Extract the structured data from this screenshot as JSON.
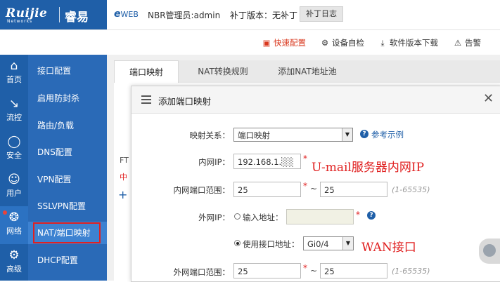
{
  "brand": {
    "logo_text": "Ruijie",
    "logo_sub": "Networks",
    "logo_cn": "睿易"
  },
  "header": {
    "eweb": "e",
    "eweb_suffix": "WEB",
    "admin_label": "NBR管理员:admin",
    "patch_label": "补丁版本：无补丁",
    "patch_log_button": "补丁日志"
  },
  "toolbar": {
    "quick_config": "快速配置",
    "device_check": "设备自检",
    "software_download": "软件版本下载",
    "alert": "告警"
  },
  "nav": [
    {
      "label": "首页",
      "icon": "home-icon"
    },
    {
      "label": "流控",
      "icon": "chart-icon"
    },
    {
      "label": "安全",
      "icon": "shield-icon"
    },
    {
      "label": "用户",
      "icon": "user-icon"
    },
    {
      "label": "网络",
      "icon": "globe-icon"
    },
    {
      "label": "高级",
      "icon": "gear-icon"
    }
  ],
  "subnav": [
    {
      "label": "接口配置"
    },
    {
      "label": "启用防封杀"
    },
    {
      "label": "路由/负载"
    },
    {
      "label": "DNS配置"
    },
    {
      "label": "VPN配置"
    },
    {
      "label": "SSLVPN配置"
    },
    {
      "label": "NAT/端口映射"
    },
    {
      "label": "DHCP配置"
    }
  ],
  "tabs": [
    {
      "label": "端口映射"
    },
    {
      "label": "NAT转换规则"
    },
    {
      "label": "添加NAT地址池"
    }
  ],
  "background": {
    "ft": "FT",
    "zh": "中",
    "plus": "+"
  },
  "dialog": {
    "title": "添加端口映射",
    "mapping_label": "映射关系：",
    "mapping_value": "端口映射",
    "example_link": "参考示例",
    "inner_ip_label": "内网IP：",
    "inner_ip_value": "192.168.1.░░",
    "inner_port_label": "内网端口范围：",
    "inner_port_from": "25",
    "inner_port_to": "25",
    "port_hint": "(1-65535)",
    "outer_ip_label": "外网IP：",
    "input_addr_label": "输入地址：",
    "use_iface_label": "使用接口地址：",
    "iface_value": "Gi0/4",
    "outer_port_label": "外网端口范围：",
    "outer_port_from": "25",
    "outer_port_to": "25",
    "tilde": "~",
    "star": "*"
  },
  "annotations": {
    "inner_ip_note": "U-mail服务器内网IP",
    "wan_note": "WAN接口"
  },
  "colors": {
    "brand_blue": "#1f5fa8",
    "annotation_red": "#e02020"
  }
}
